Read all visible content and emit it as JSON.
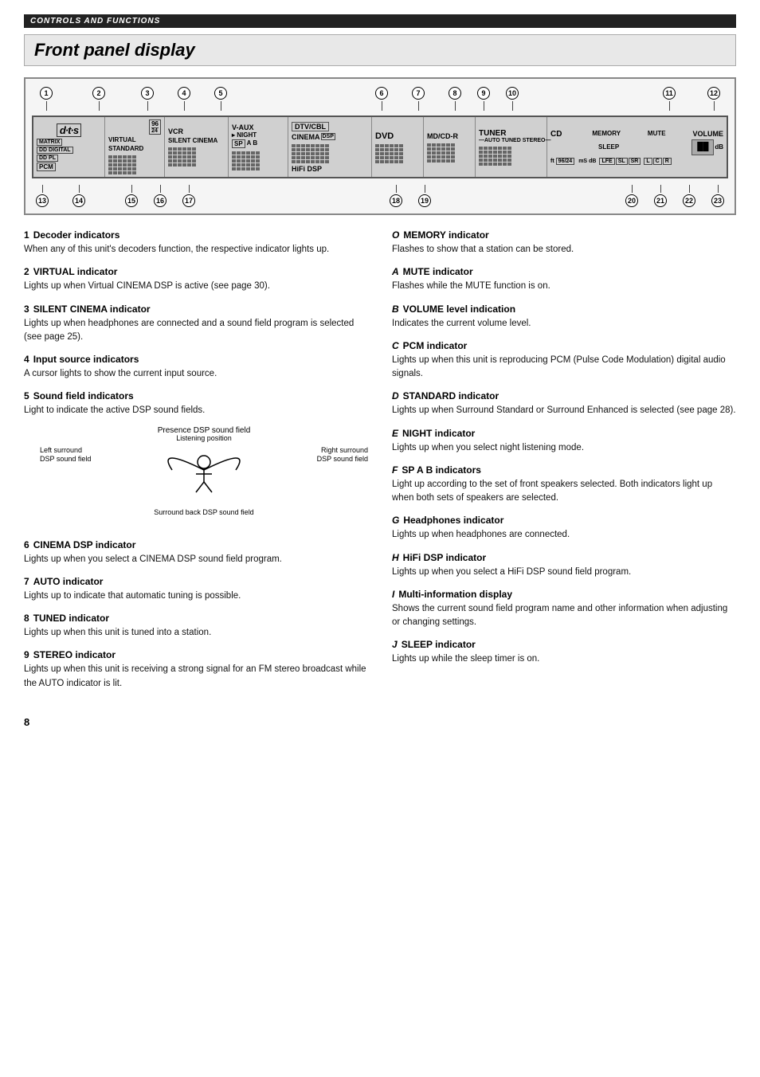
{
  "top_bar": "CONTROLS AND FUNCTIONS",
  "page_title": "Front panel display",
  "diagram": {
    "callouts_top": [
      "1",
      "2",
      "3",
      "4",
      "5",
      "6",
      "7",
      "8",
      "9",
      "10",
      "11",
      "12"
    ],
    "callouts_bottom": [
      "13",
      "14",
      "15",
      "16",
      "17",
      "18",
      "19",
      "20",
      "21",
      "22",
      "23"
    ],
    "lcd_sections": [
      {
        "label": "dts / MATRIX / DD DIGITAL / DD PL / PCM"
      },
      {
        "label": "96/24 / VIRTUAL / STANDARD"
      },
      {
        "label": "VCR / SILENT CINEMA"
      },
      {
        "label": "V-AUX / NIGHT / SP AB"
      },
      {
        "label": "DTV/CBL / CINEMA"
      },
      {
        "label": "DVD / HiFi DSP"
      },
      {
        "label": "MD/CD-R"
      },
      {
        "label": "TUNER / AUTO TUNED STEREO"
      },
      {
        "label": "CD / MEMORY / MUTE / VOLUME / SLEEP"
      },
      {
        "label": "ft / 96/24 / mS dB / LFE SL SR / L C R"
      }
    ]
  },
  "sections_left": [
    {
      "num": "1",
      "heading": "Decoder indicators",
      "text": "When any of this unit's decoders function, the respective indicator lights up."
    },
    {
      "num": "2",
      "heading": "VIRTUAL indicator",
      "text": "Lights up when Virtual CINEMA DSP is active (see page 30)."
    },
    {
      "num": "3",
      "heading": "SILENT CINEMA indicator",
      "text": "Lights up when headphones are connected and a sound field program is selected (see page 25)."
    },
    {
      "num": "4",
      "heading": "Input source indicators",
      "text": "A cursor lights to show the current input source."
    },
    {
      "num": "5",
      "heading": "Sound field indicators",
      "text": "Light to indicate the active DSP sound fields."
    },
    {
      "num": "6",
      "heading": "CINEMA DSP indicator",
      "text": "Lights up when you select a CINEMA DSP sound field program."
    },
    {
      "num": "7",
      "heading": "AUTO indicator",
      "text": "Lights up to indicate that automatic tuning is possible."
    },
    {
      "num": "8",
      "heading": "TUNED indicator",
      "text": "Lights up when this unit is tuned into a station."
    },
    {
      "num": "9",
      "heading": "STEREO indicator",
      "text": "Lights up when this unit is receiving a strong signal for an FM stereo broadcast while the AUTO indicator is lit."
    }
  ],
  "sections_right": [
    {
      "letter": "O",
      "heading": "MEMORY indicator",
      "text": "Flashes to show that a station can be stored."
    },
    {
      "letter": "A",
      "heading": "MUTE indicator",
      "text": "Flashes while the MUTE function is on."
    },
    {
      "letter": "B",
      "heading": "VOLUME level indication",
      "text": "Indicates the current volume level."
    },
    {
      "letter": "C",
      "heading": "PCM indicator",
      "text": "Lights up when this unit is reproducing PCM (Pulse Code Modulation) digital audio signals."
    },
    {
      "letter": "D",
      "heading": "STANDARD indicator",
      "text": "Lights up when Surround Standard or Surround Enhanced is selected (see page 28)."
    },
    {
      "letter": "E",
      "heading": "NIGHT indicator",
      "text": "Lights up when you select night listening mode."
    },
    {
      "letter": "F",
      "heading": "SP A B indicators",
      "text": "Light up according to the set of front speakers selected. Both indicators light up when both sets of speakers are selected."
    },
    {
      "letter": "G",
      "heading": "Headphones indicator",
      "text": "Lights up when headphones are connected."
    },
    {
      "letter": "H",
      "heading": "HiFi DSP indicator",
      "text": "Lights up when you select a HiFi DSP sound field program."
    },
    {
      "letter": "I",
      "heading": "Multi-information display",
      "text": "Shows the current sound field program name and other information when adjusting or changing settings."
    },
    {
      "letter": "J",
      "heading": "SLEEP indicator",
      "text": "Lights up while the sleep timer is on."
    }
  ],
  "diagram_labels": {
    "presence": "Presence DSP sound field",
    "listening": "Listening position",
    "left_surround": "Left surround\nDSP sound field",
    "right_surround": "Right surround\nDSP sound field",
    "surround_back": "Surround back DSP sound field"
  },
  "page_number": "8"
}
